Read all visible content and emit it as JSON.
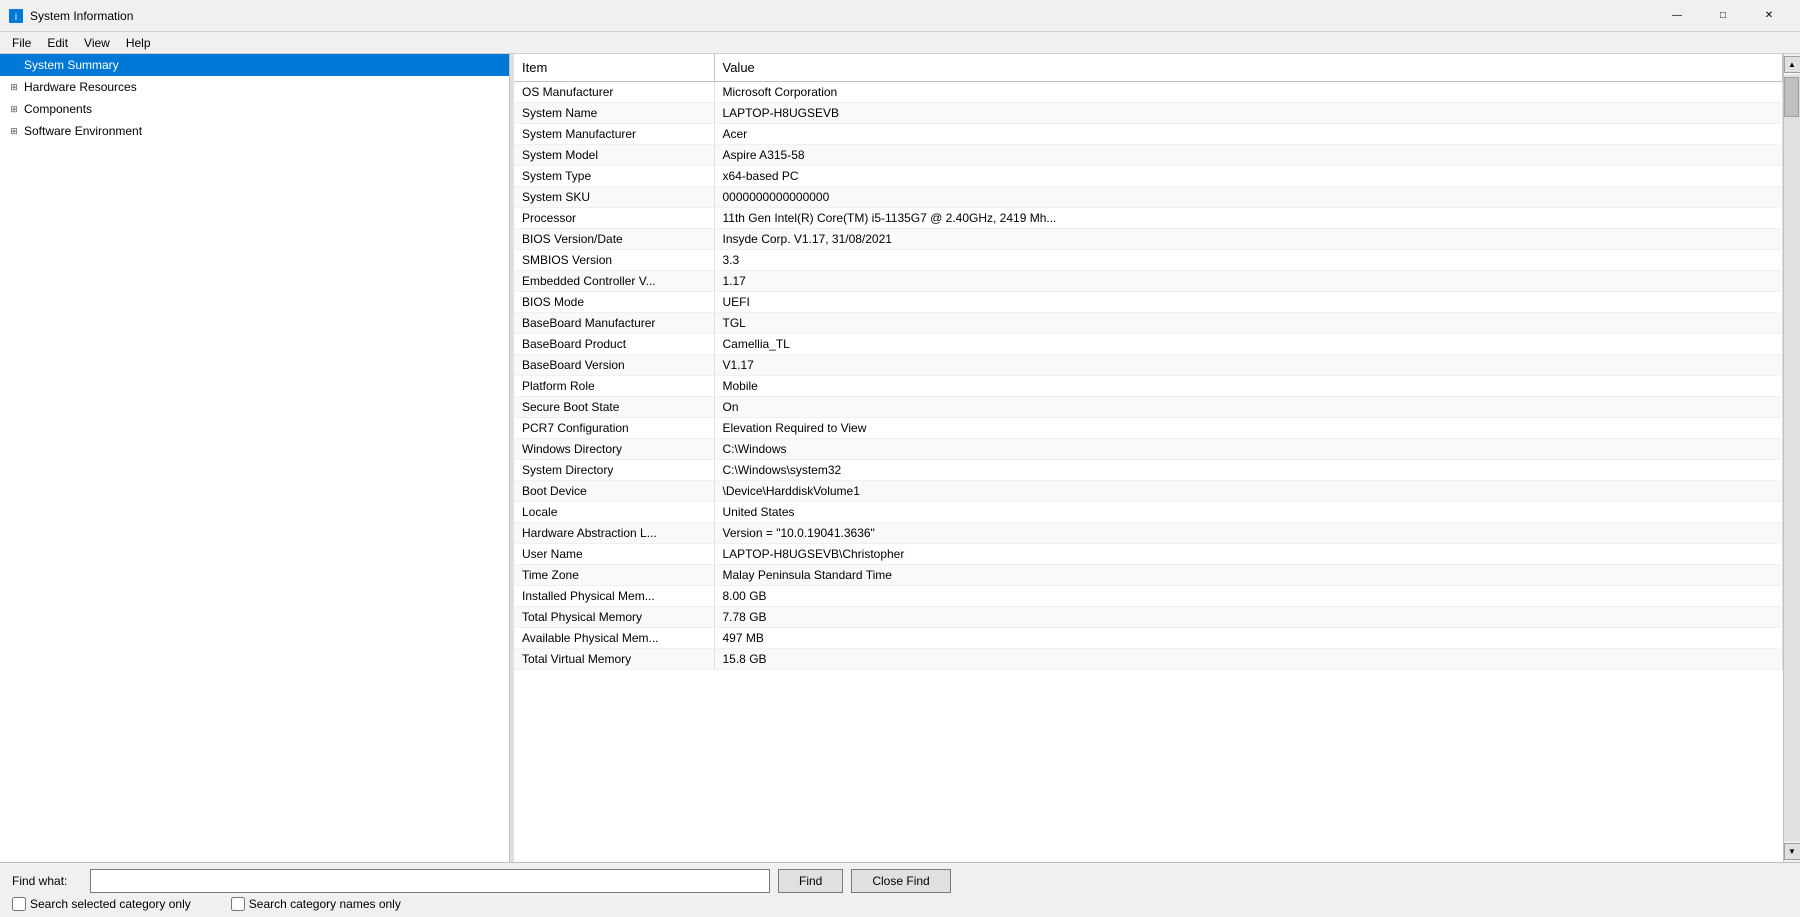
{
  "window": {
    "title": "System Information",
    "icon": "ℹ"
  },
  "titlebar": {
    "minimize_label": "—",
    "maximize_label": "□",
    "close_label": "✕"
  },
  "menubar": {
    "items": [
      {
        "label": "File",
        "id": "file"
      },
      {
        "label": "Edit",
        "id": "edit"
      },
      {
        "label": "View",
        "id": "view"
      },
      {
        "label": "Help",
        "id": "help"
      }
    ]
  },
  "sidebar": {
    "items": [
      {
        "label": "System Summary",
        "id": "system-summary",
        "selected": true,
        "level": 0,
        "hasExpander": false
      },
      {
        "label": "Hardware Resources",
        "id": "hardware-resources",
        "selected": false,
        "level": 0,
        "hasExpander": true,
        "expanded": false
      },
      {
        "label": "Components",
        "id": "components",
        "selected": false,
        "level": 0,
        "hasExpander": true,
        "expanded": false
      },
      {
        "label": "Software Environment",
        "id": "software-environment",
        "selected": false,
        "level": 0,
        "hasExpander": true,
        "expanded": false
      }
    ]
  },
  "table": {
    "columns": [
      {
        "id": "item",
        "label": "Item"
      },
      {
        "id": "value",
        "label": "Value"
      }
    ],
    "rows": [
      {
        "item": "OS Manufacturer",
        "value": "Microsoft Corporation"
      },
      {
        "item": "System Name",
        "value": "LAPTOP-H8UGSEVB"
      },
      {
        "item": "System Manufacturer",
        "value": "Acer"
      },
      {
        "item": "System Model",
        "value": "Aspire A315-58"
      },
      {
        "item": "System Type",
        "value": "x64-based PC"
      },
      {
        "item": "System SKU",
        "value": "0000000000000000"
      },
      {
        "item": "Processor",
        "value": "11th Gen Intel(R) Core(TM) i5-1135G7 @ 2.40GHz, 2419 Mh..."
      },
      {
        "item": "BIOS Version/Date",
        "value": "Insyde Corp. V1.17, 31/08/2021"
      },
      {
        "item": "SMBIOS Version",
        "value": "3.3"
      },
      {
        "item": "Embedded Controller V...",
        "value": "1.17"
      },
      {
        "item": "BIOS Mode",
        "value": "UEFI"
      },
      {
        "item": "BaseBoard Manufacturer",
        "value": "TGL"
      },
      {
        "item": "BaseBoard Product",
        "value": "Camellia_TL"
      },
      {
        "item": "BaseBoard Version",
        "value": "V1.17"
      },
      {
        "item": "Platform Role",
        "value": "Mobile"
      },
      {
        "item": "Secure Boot State",
        "value": "On"
      },
      {
        "item": "PCR7 Configuration",
        "value": "Elevation Required to View"
      },
      {
        "item": "Windows Directory",
        "value": "C:\\Windows"
      },
      {
        "item": "System Directory",
        "value": "C:\\Windows\\system32"
      },
      {
        "item": "Boot Device",
        "value": "\\Device\\HarddiskVolume1"
      },
      {
        "item": "Locale",
        "value": "United States"
      },
      {
        "item": "Hardware Abstraction L...",
        "value": "Version = \"10.0.19041.3636\""
      },
      {
        "item": "User Name",
        "value": "LAPTOP-H8UGSEVB\\Christopher"
      },
      {
        "item": "Time Zone",
        "value": "Malay Peninsula Standard Time"
      },
      {
        "item": "Installed Physical Mem...",
        "value": "8.00 GB"
      },
      {
        "item": "Total Physical Memory",
        "value": "7.78 GB"
      },
      {
        "item": "Available Physical Mem...",
        "value": "497 MB"
      },
      {
        "item": "Total Virtual Memory",
        "value": "15.8 GB"
      }
    ]
  },
  "findbar": {
    "label": "Find what:",
    "placeholder": "",
    "find_button": "Find",
    "close_find_button": "Close Find",
    "checkbox1_label": "Search selected category only",
    "checkbox2_label": "Search category names only"
  }
}
